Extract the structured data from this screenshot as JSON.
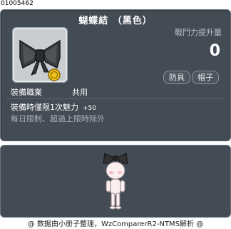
{
  "item_id": "01005462",
  "item_name": "蝴蝶結 （黑色）",
  "combat_power": {
    "label": "戰鬥力提升量",
    "value": "0"
  },
  "tags": [
    "防具",
    "帽子"
  ],
  "job": {
    "label": "裝備職業",
    "value": "共用"
  },
  "effect": {
    "text": "裝備時僅限1次魅力",
    "bonus": "+50"
  },
  "restriction": "每日限制、超過上限時除外",
  "footer": "@ 数据由小册子整理，WzComparerR2-NTMS解析 @",
  "icons": {
    "item_icon": "black-ribbon-bow-icon",
    "badge": "gold-coin-badge-icon",
    "preview": "character-preview-figure"
  }
}
